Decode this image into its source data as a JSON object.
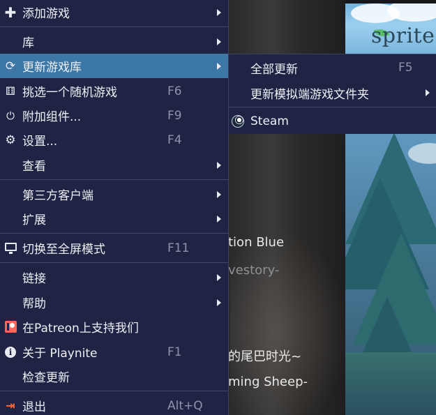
{
  "background": {
    "logo_text": "sprite",
    "texts": [
      {
        "text": "tion Blue",
        "dim": false
      },
      {
        "text": "vestory-",
        "dim": true
      },
      {
        "text": "的尾巴时光~",
        "dim": false
      },
      {
        "text": "ming Sheep-",
        "dim": false
      }
    ]
  },
  "menu": {
    "items": [
      {
        "label": "添加游戏",
        "shortcut": "",
        "icon": "plus-icon",
        "submenu": true
      },
      {
        "label": "库",
        "shortcut": "",
        "icon": "",
        "submenu": true
      },
      {
        "label": "更新游戏库",
        "shortcut": "",
        "icon": "refresh-icon",
        "submenu": true,
        "active": true
      },
      {
        "label": "挑选一个随机游戏",
        "shortcut": "F6",
        "icon": "dice-icon",
        "submenu": false
      },
      {
        "label": "附加组件...",
        "shortcut": "F9",
        "icon": "addon-plug-icon",
        "submenu": false
      },
      {
        "label": "设置...",
        "shortcut": "F4",
        "icon": "gear-icon",
        "submenu": false
      },
      {
        "label": "查看",
        "shortcut": "",
        "icon": "",
        "submenu": true
      },
      {
        "label": "第三方客户端",
        "shortcut": "",
        "icon": "",
        "submenu": true
      },
      {
        "label": "扩展",
        "shortcut": "",
        "icon": "",
        "submenu": true
      },
      {
        "label": "切换至全屏模式",
        "shortcut": "F11",
        "icon": "monitor-icon",
        "submenu": false
      },
      {
        "label": "链接",
        "shortcut": "",
        "icon": "",
        "submenu": true
      },
      {
        "label": "帮助",
        "shortcut": "",
        "icon": "",
        "submenu": true
      },
      {
        "label": "在Patreon上支持我们",
        "shortcut": "",
        "icon": "patreon-icon",
        "submenu": false
      },
      {
        "label": "关于 Playnite",
        "shortcut": "F1",
        "icon": "info-icon",
        "submenu": false
      },
      {
        "label": "检查更新",
        "shortcut": "",
        "icon": "",
        "submenu": false
      },
      {
        "label": "退出",
        "shortcut": "Alt+Q",
        "icon": "exit-icon",
        "submenu": false
      }
    ]
  },
  "submenu": {
    "items": [
      {
        "label": "全部更新",
        "shortcut": "F5",
        "icon": "",
        "submenu": false
      },
      {
        "label": "更新模拟端游戏文件夹",
        "shortcut": "",
        "icon": "",
        "submenu": true
      },
      {
        "label": "Steam",
        "shortcut": "",
        "icon": "steam-icon",
        "submenu": false
      }
    ]
  },
  "colors": {
    "menu_bg": "#1f2445",
    "active_bg": "#3d77a5",
    "separator": "#3d4470",
    "shortcut_text": "#8e93ad",
    "exit_icon": "#ff6a3c",
    "patreon": "#f96854"
  }
}
